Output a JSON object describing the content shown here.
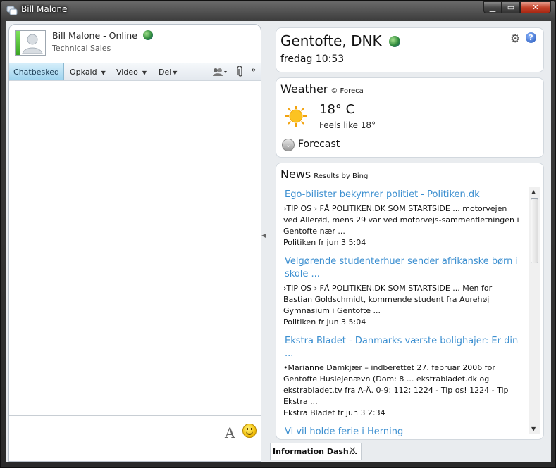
{
  "window": {
    "title": "Bill Malone"
  },
  "contact": {
    "name": "Bill Malone - Online",
    "title": "Technical Sales"
  },
  "toolbar": {
    "chat": "Chatbesked",
    "call": "Opkald",
    "video": "Video",
    "share": "Del",
    "more": "»"
  },
  "location": {
    "title": "Gentofte, DNK",
    "time": "fredag 10:53"
  },
  "weather": {
    "title": "Weather",
    "credit": "© Foreca",
    "temperature": "18° C",
    "feels_like": "Feels like  18°",
    "forecast_label": "Forecast"
  },
  "news": {
    "title": "News",
    "credit": "Results by Bing",
    "items": [
      {
        "headline": "Ego-bilister bekymrer politiet - Politiken.dk",
        "snippet": "›TIP OS › FÅ POLITIKEN.DK SOM STARTSIDE ... motorvejen ved Allerød, mens 29 var ved motorvejs-sammenfletningen i Gentofte nær ...",
        "source": "Politiken  fr jun 3 5:04"
      },
      {
        "headline": "Velgørende studenterhuer sender afrikanske børn i skole ...",
        "snippet": "›TIP OS › FÅ POLITIKEN.DK SOM STARTSIDE ... Men for Bastian Goldschmidt, kommende student fra Aurehøj Gymnasium i Gentofte ...",
        "source": "Politiken  fr jun 3 5:04"
      },
      {
        "headline": "Ekstra Bladet - Danmarks værste bolighajer: Er din ...",
        "snippet": "•Marianne Damkjær – indberettet 27. februar 2006 for Gentofte Huslejenævn (Dom: 8 ... ekstrabladet.dk og ekstrabladet.tv fra A-Å. 0-9; 112; 1224 - Tip os! 1224 - Tip Ekstra ...",
        "source": "Ekstra Bladet  fr jun 3 2:34"
      },
      {
        "headline": "Vi vil holde ferie i Herning",
        "snippet": "",
        "source": ""
      }
    ]
  },
  "bottom_tab": {
    "label": "Information Dash...",
    "close": "✕"
  },
  "colors": {
    "link": "#3c8fd0",
    "active_tab": "#9dd3ef",
    "presence": "#3ba625"
  }
}
